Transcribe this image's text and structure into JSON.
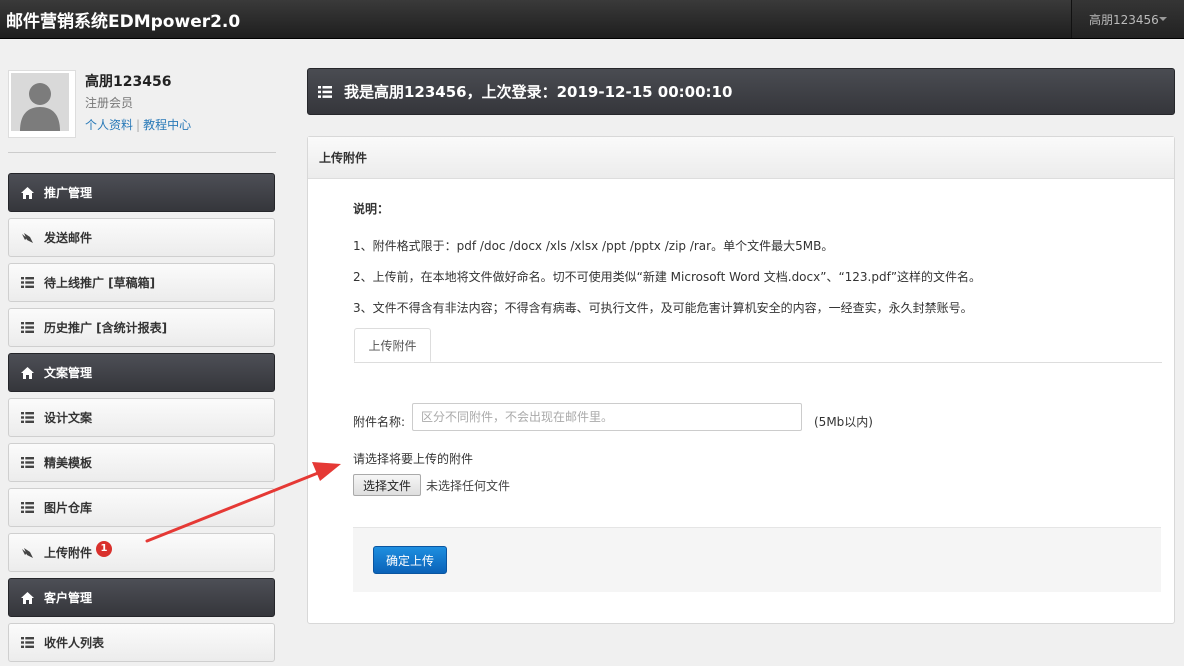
{
  "app": {
    "title": "邮件营销系统EDMpower2.0"
  },
  "user_menu": {
    "username": "高朋123456"
  },
  "profile": {
    "name": "高朋123456",
    "role": "注册会员",
    "links": [
      "个人资料",
      "教程中心"
    ],
    "separator": "|"
  },
  "sidebar": {
    "items": [
      {
        "label": "推广管理",
        "icon": "home-icon",
        "style": "section"
      },
      {
        "label": "发送邮件",
        "icon": "send-icon",
        "style": "item"
      },
      {
        "label": "待上线推广 [草稿箱]",
        "icon": "list-icon",
        "style": "item"
      },
      {
        "label": "历史推广 [含统计报表]",
        "icon": "list-icon",
        "style": "item"
      },
      {
        "label": "文案管理",
        "icon": "home-icon",
        "style": "section"
      },
      {
        "label": "设计文案",
        "icon": "list-icon",
        "style": "item"
      },
      {
        "label": "精美模板",
        "icon": "list-icon",
        "style": "item"
      },
      {
        "label": "图片仓库",
        "icon": "list-icon",
        "style": "item"
      },
      {
        "label": "上传附件",
        "icon": "send-icon",
        "style": "item",
        "badge": "1"
      },
      {
        "label": "客户管理",
        "icon": "home-icon",
        "style": "section"
      },
      {
        "label": "收件人列表",
        "icon": "list-icon",
        "style": "item"
      }
    ]
  },
  "main": {
    "header": "我是高朋123456，上次登录：2019-12-15 00:00:10",
    "panel_title": "上传附件",
    "notes": {
      "title": "说明：",
      "lines": [
        "1、附件格式限于：pdf /doc /docx /xls /xlsx /ppt /pptx /zip /rar。单个文件最大5MB。",
        "2、上传前，在本地将文件做好命名。切不可使用类似“新建 Microsoft Word 文档.docx”、“123.pdf”这样的文件名。",
        "3、文件不得含有非法内容；不得含有病毒、可执行文件，及可能危害计算机安全的内容，一经查实，永久封禁账号。"
      ]
    },
    "tab": "上传附件",
    "form": {
      "name_label": "附件名称:",
      "name_value": "",
      "name_placeholder": "区分不同附件，不会出现在邮件里。",
      "name_hint": "(5Mb以内)",
      "file_label": "请选择将要上传的附件",
      "file_button": "选择文件",
      "file_status": "未选择任何文件",
      "submit": "确定上传"
    }
  },
  "colors": {
    "topbar": "#2b2b2b",
    "dark_section": "#3f4046",
    "link": "#2a7ab8",
    "badge": "#d9302c",
    "primary_button": "#1478cc",
    "annotation_arrow": "#e53935"
  }
}
